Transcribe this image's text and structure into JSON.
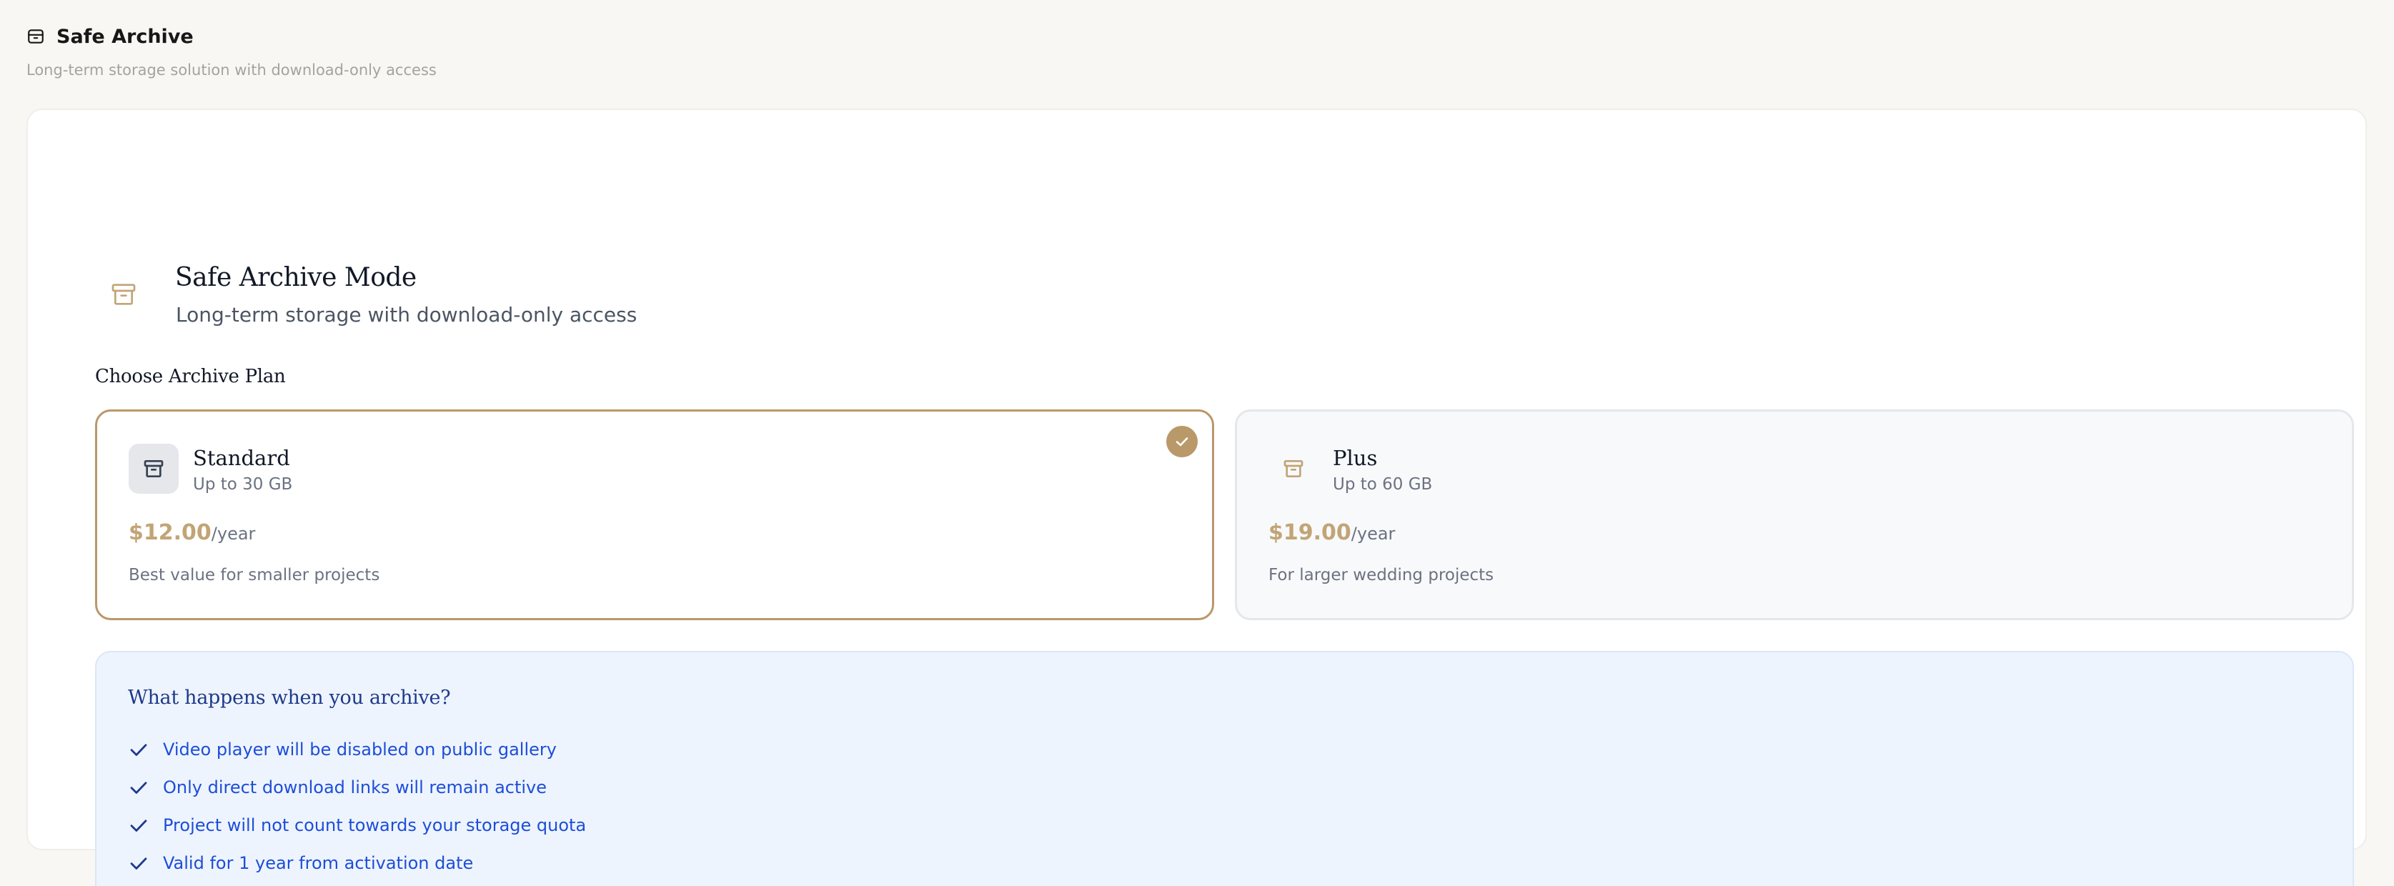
{
  "header": {
    "title": "Safe Archive",
    "subtitle": "Long-term storage solution with download-only access",
    "icon": "archive-icon"
  },
  "mode": {
    "title": "Safe Archive Mode",
    "subtitle": "Long-term storage with download-only access",
    "icon": "archive-icon"
  },
  "plans": {
    "heading": "Choose Archive Plan",
    "items": [
      {
        "name": "Standard",
        "capacity": "Up to 30 GB",
        "price": "$12.00",
        "period": "/year",
        "description": "Best value for smaller projects",
        "selected": true,
        "icon": "archive-icon"
      },
      {
        "name": "Plus",
        "capacity": "Up to 60 GB",
        "price": "$19.00",
        "period": "/year",
        "description": "For larger wedding projects",
        "selected": false,
        "icon": "archive-icon"
      }
    ]
  },
  "info": {
    "title": "What happens when you archive?",
    "items": [
      "Video player will be disabled on public gallery",
      "Only direct download links will remain active",
      "Project will not count towards your storage quota",
      "Valid for 1 year from activation date"
    ]
  },
  "colors": {
    "accent": "#b9986a",
    "price": "#c2a476",
    "info_background": "#eef4fe",
    "info_text": "#1d4ed8",
    "info_title": "#1e3a8a"
  }
}
